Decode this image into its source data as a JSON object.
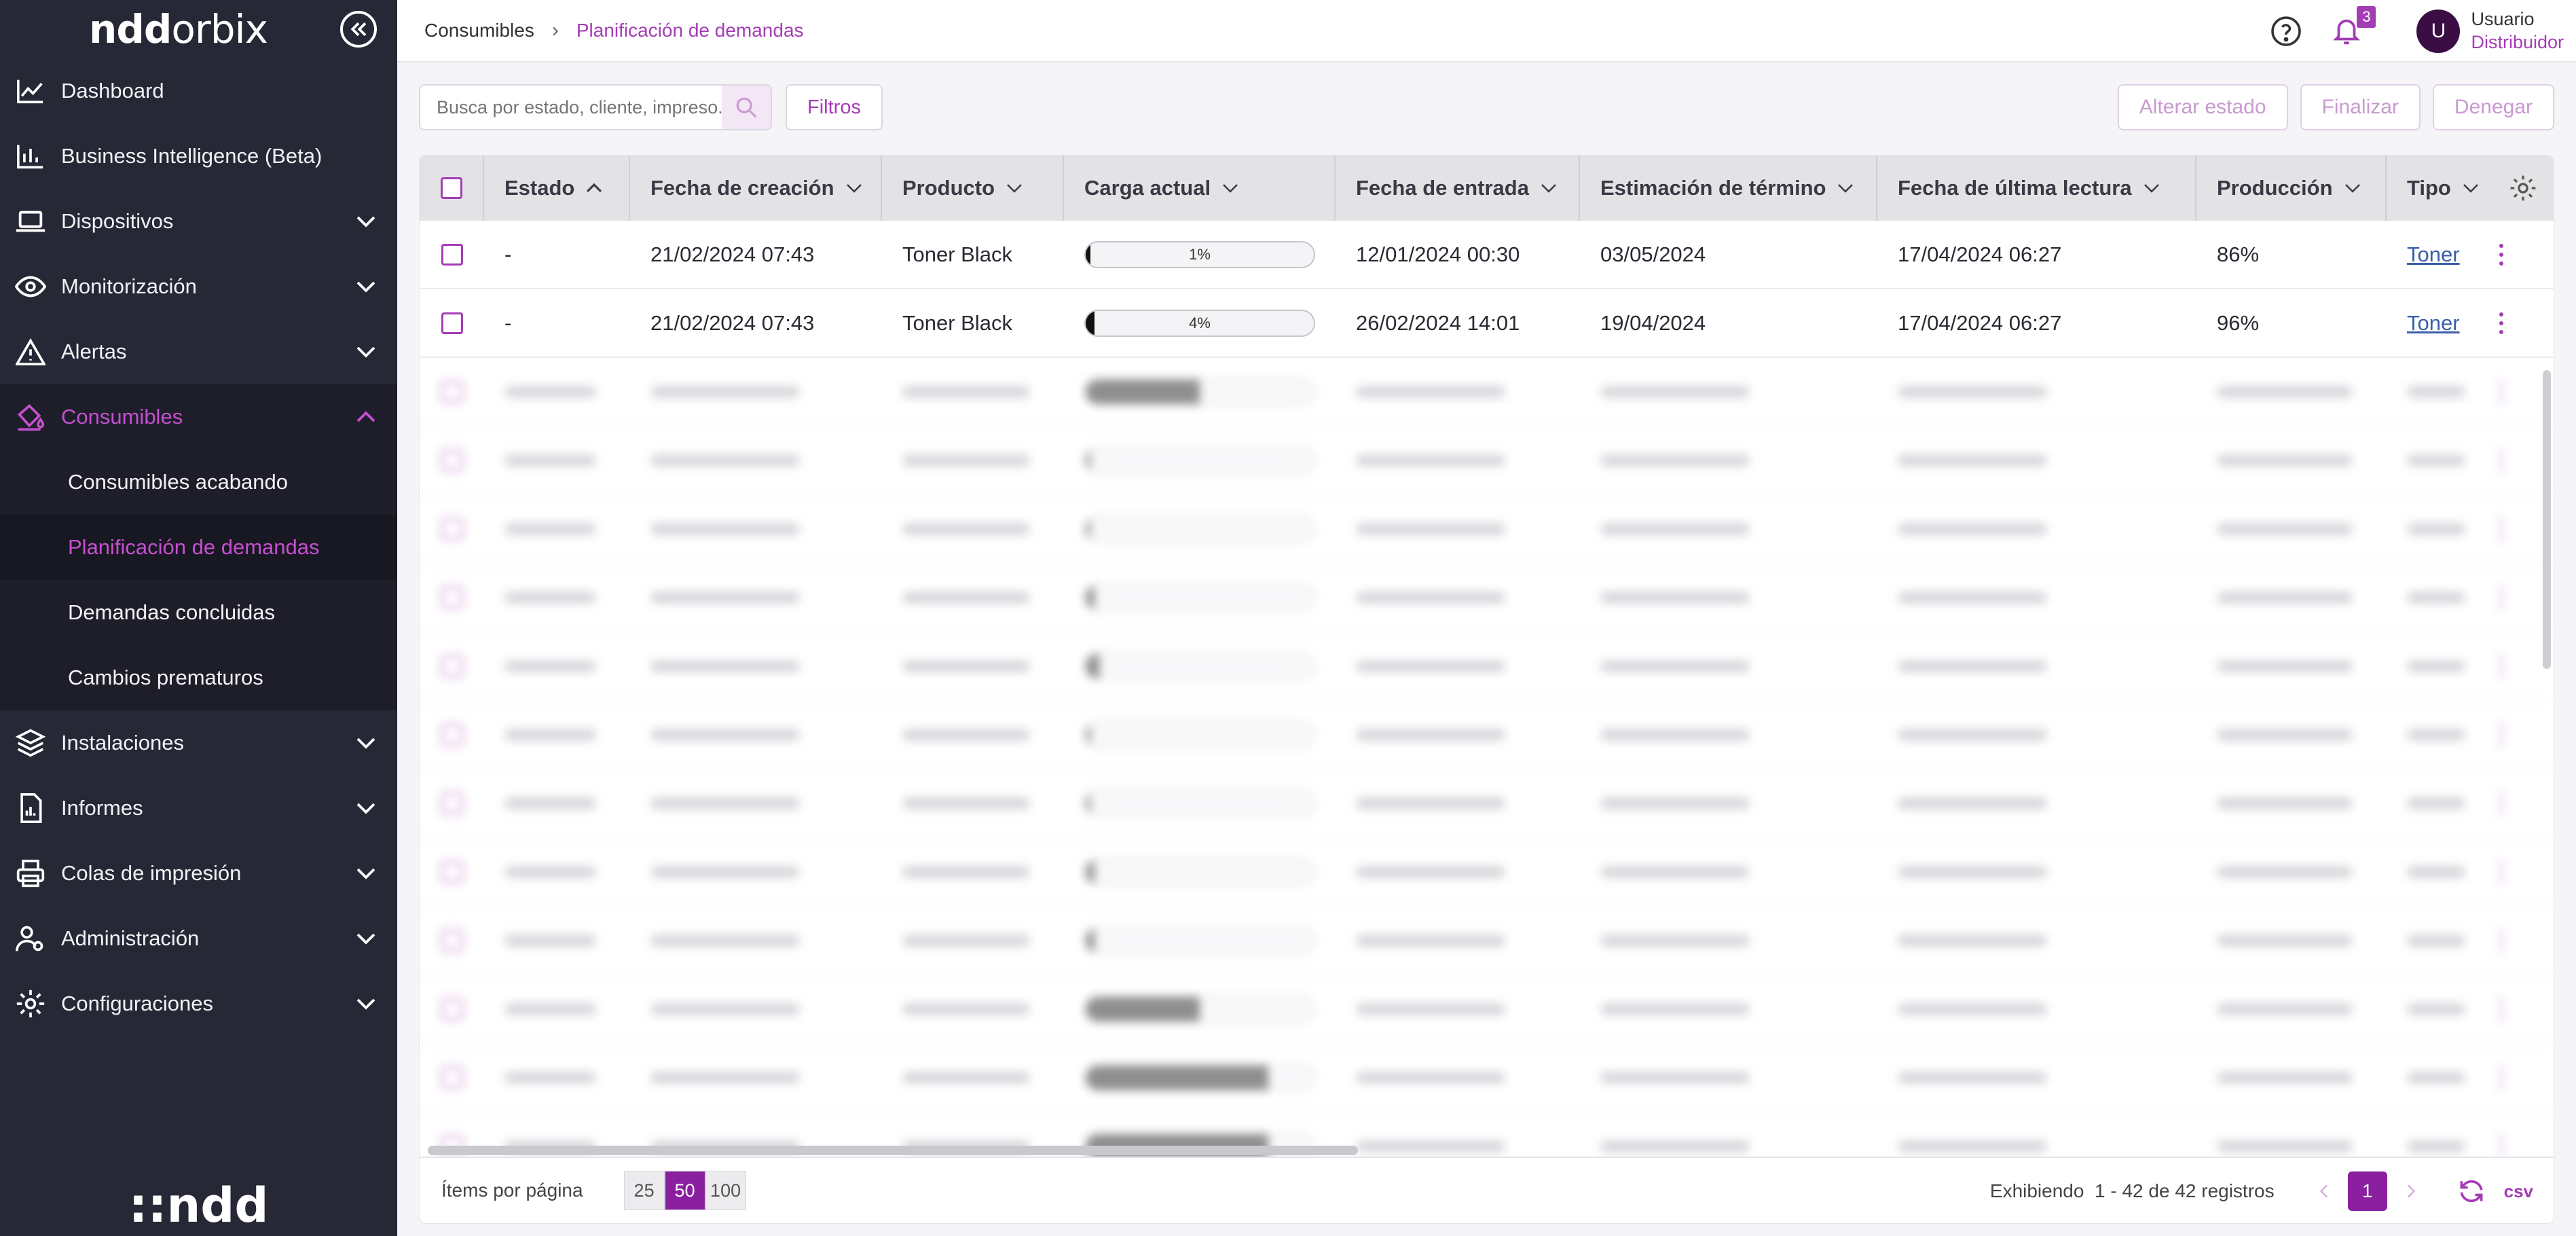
{
  "brand": {
    "logo_bold": "ndd",
    "logo_light": "orbix",
    "footer_logo": "::ndd"
  },
  "sidebar": {
    "items": [
      {
        "label": "Dashboard",
        "icon": "chart-line-icon"
      },
      {
        "label": "Business Intelligence (Beta)",
        "icon": "bar-chart-icon"
      },
      {
        "label": "Dispositivos",
        "icon": "laptop-icon"
      },
      {
        "label": "Monitorización",
        "icon": "eye-icon"
      },
      {
        "label": "Alertas",
        "icon": "warning-icon"
      },
      {
        "label": "Consumibles",
        "icon": "ink-icon"
      },
      {
        "label": "Instalaciones",
        "icon": "layers-icon"
      },
      {
        "label": "Informes",
        "icon": "report-icon"
      },
      {
        "label": "Colas de impresión",
        "icon": "printer-icon"
      },
      {
        "label": "Administración",
        "icon": "users-icon"
      },
      {
        "label": "Configuraciones",
        "icon": "gear-icon"
      }
    ],
    "consumibles_sub": [
      {
        "label": "Consumibles acabando"
      },
      {
        "label": "Planificación de demandas"
      },
      {
        "label": "Demandas concluidas"
      },
      {
        "label": "Cambios prematuros"
      }
    ]
  },
  "header": {
    "breadcrumb_root": "Consumibles",
    "breadcrumb_current": "Planificación de demandas",
    "notifications_count": "3",
    "avatar_letter": "U",
    "user_name": "Usuario",
    "user_role": "Distribuidor"
  },
  "toolbar": {
    "search_placeholder": "Busca por estado, cliente, impreso...",
    "filters_label": "Filtros",
    "change_state_label": "Alterar estado",
    "finish_label": "Finalizar",
    "deny_label": "Denegar"
  },
  "table": {
    "columns": [
      "Estado",
      "Fecha de creación",
      "Producto",
      "Carga actual",
      "Fecha de entrada",
      "Estimación de término",
      "Fecha de última lectura",
      "Producción",
      "Tipo"
    ],
    "rows": [
      {
        "estado": "-",
        "creacion": "21/02/2024 07:43",
        "producto": "Toner Black",
        "carga": 0.01,
        "carga_label": "1%",
        "entrada": "12/01/2024 00:30",
        "termino": "03/05/2024",
        "lectura": "17/04/2024 06:27",
        "produccion": "86%",
        "tipo": "Toner"
      },
      {
        "estado": "-",
        "creacion": "21/02/2024 07:43",
        "producto": "Toner Black",
        "carga": 0.04,
        "carga_label": "4%",
        "entrada": "26/02/2024 14:01",
        "termino": "19/04/2024",
        "lectura": "17/04/2024 06:27",
        "produccion": "96%",
        "tipo": "Toner"
      }
    ]
  },
  "footer": {
    "per_page_label": "Ítems por página",
    "per_page_options": [
      "25",
      "50",
      "100"
    ],
    "showing_label": "Exhibiendo",
    "showing_range": "1 - 42 de 42 registros",
    "current_page": "1",
    "csv_label": "csv"
  },
  "colors": {
    "accent": "#a43cb5",
    "sidebar_bg": "#272836",
    "active_page": "#8a1fa0"
  }
}
